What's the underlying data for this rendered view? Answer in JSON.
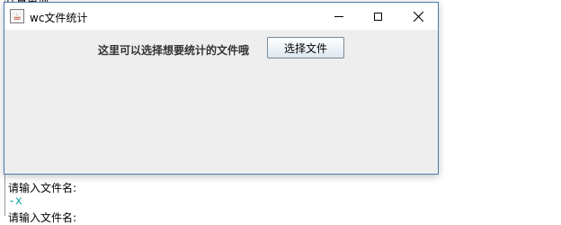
{
  "window": {
    "title": "wc文件统计",
    "controls": {
      "minimize_icon": "minimize-icon",
      "maximize_icon": "maximize-icon",
      "close_icon": "close-icon"
    }
  },
  "main": {
    "prompt": "这里可以选择想要统计的文件哦",
    "choose_button": "选择文件"
  },
  "console": {
    "top_text": "计算单词",
    "lines": [
      "请输入文件名:",
      "-x",
      "请输入文件名:"
    ]
  }
}
